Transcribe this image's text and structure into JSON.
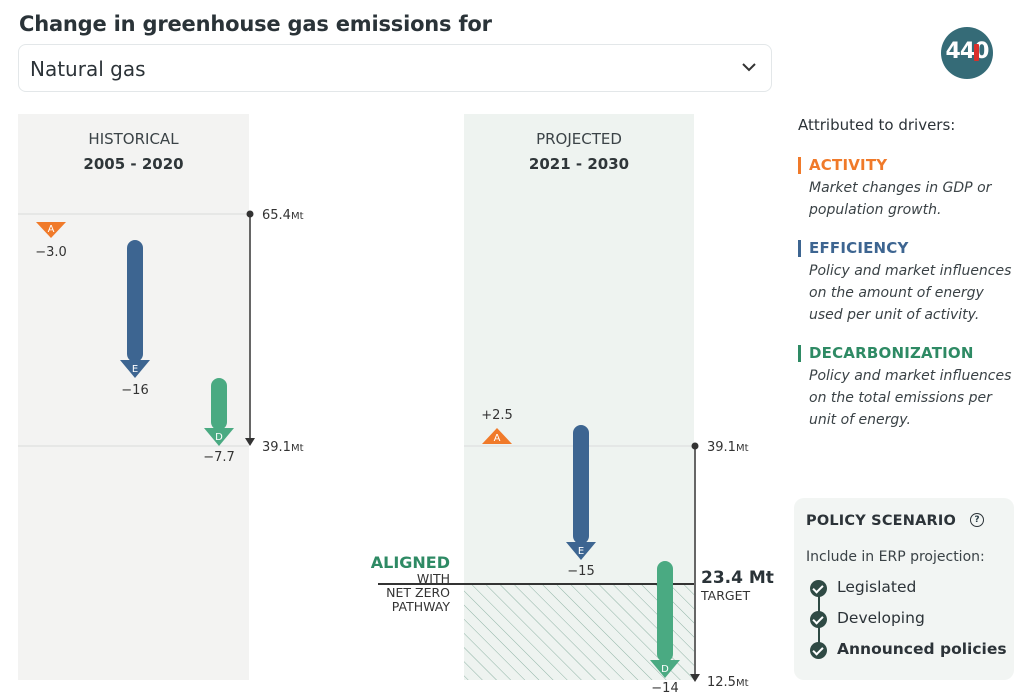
{
  "header": {
    "title": "Change in greenhouse gas emissions for",
    "selected_sector": "Natural gas",
    "logo_text": "440"
  },
  "historical": {
    "label": "HISTORICAL",
    "period": "2005 - 2020"
  },
  "projected": {
    "label": "PROJECTED",
    "period": "2021 - 2030"
  },
  "target": {
    "aligned": "ALIGNED",
    "line1": "WITH",
    "line2": "NET ZERO",
    "line3": "PATHWAY",
    "value_label": "23.4 Mt",
    "target_label": "TARGET"
  },
  "chart_data": {
    "type": "waterfall",
    "unit": "Mt",
    "ylim": [
      12.5,
      65.4
    ],
    "colors": {
      "activity": "#f07a2a",
      "efficiency": "#3d6591",
      "decarbonization": "#4aaa82"
    },
    "historical": {
      "start": 65.4,
      "start_label": "65.4",
      "end": 39.1,
      "end_label": "39.1",
      "drivers": [
        {
          "key": "A",
          "driver": "activity",
          "value": -3.0,
          "label": "−3.0"
        },
        {
          "key": "E",
          "driver": "efficiency",
          "value": -16,
          "label": "−16"
        },
        {
          "key": "D",
          "driver": "decarbonization",
          "value": -7.7,
          "label": "−7.7"
        }
      ]
    },
    "projected": {
      "start": 39.1,
      "start_label": "39.1",
      "end": 12.5,
      "end_label": "12.5",
      "target": 23.4,
      "drivers": [
        {
          "key": "A",
          "driver": "activity",
          "value": 2.5,
          "label": "+2.5"
        },
        {
          "key": "E",
          "driver": "efficiency",
          "value": -15,
          "label": "−15"
        },
        {
          "key": "D",
          "driver": "decarbonization",
          "value": -14,
          "label": "−14"
        }
      ]
    }
  },
  "legend": {
    "title": "Attributed to drivers:",
    "items": [
      {
        "name": "ACTIVITY",
        "color": "#f07a2a",
        "desc": "Market changes in GDP or population growth."
      },
      {
        "name": "EFFICIENCY",
        "color": "#3d6591",
        "desc": "Policy and market influences on the amount of energy used per unit of activity."
      },
      {
        "name": "DECARBONIZATION",
        "color": "#2e8a64",
        "desc": "Policy and market influences on the total emissions per unit of energy."
      }
    ]
  },
  "policy": {
    "title": "POLICY SCENARIO",
    "help_icon": "?",
    "subtitle": "Include in ERP projection:",
    "options": [
      {
        "label": "Legislated",
        "checked": true
      },
      {
        "label": "Developing",
        "checked": true
      },
      {
        "label": "Announced policies",
        "checked": true
      }
    ]
  }
}
